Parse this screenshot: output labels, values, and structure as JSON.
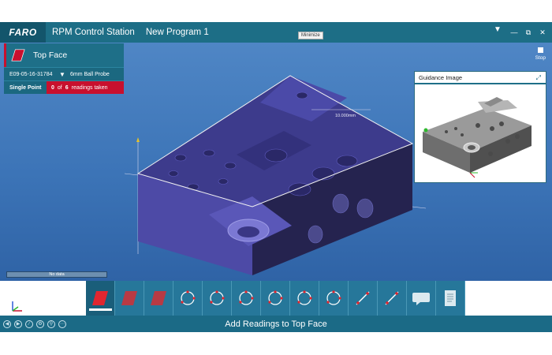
{
  "titlebar": {
    "logo": "FARO",
    "app_title": "RPM  Control Station",
    "program_title": "New Program 1",
    "tooltip": "Minimize",
    "chevron_icon": "chevron-down-icon",
    "window_buttons": [
      "min-icon",
      "restore-icon",
      "close-icon"
    ]
  },
  "stop": {
    "label": "Stop",
    "icon": "stop-icon"
  },
  "feature": {
    "name": "Top Face",
    "serial": "E09-05-16-31784",
    "probe": "6mm Ball Probe",
    "mode": "Single Point",
    "readings_taken": "0",
    "readings_of": "of",
    "readings_total": "6",
    "readings_suffix": "readings taken"
  },
  "model": {
    "dimension_label": "10.000mm"
  },
  "guidance": {
    "title": "Guidance Image",
    "expand_icon": "expand-icon"
  },
  "nodata": {
    "label": "No data"
  },
  "toolbar": {
    "tools": [
      {
        "name": "plane-red-active",
        "icon": "plane-icon"
      },
      {
        "name": "plane-red",
        "icon": "plane-icon"
      },
      {
        "name": "plane-red-2",
        "icon": "plane-icon"
      },
      {
        "name": "circle",
        "icon": "circle-points-icon"
      },
      {
        "name": "circle",
        "icon": "circle-points-icon"
      },
      {
        "name": "circle",
        "icon": "circle-points-icon"
      },
      {
        "name": "circle",
        "icon": "circle-points-icon"
      },
      {
        "name": "circle",
        "icon": "circle-points-icon"
      },
      {
        "name": "circle",
        "icon": "circle-points-icon"
      },
      {
        "name": "line",
        "icon": "line-icon"
      },
      {
        "name": "line",
        "icon": "line-icon"
      },
      {
        "name": "comment",
        "icon": "comment-icon"
      },
      {
        "name": "report",
        "icon": "report-icon"
      }
    ]
  },
  "bottombar": {
    "status": "Add Readings to Top Face",
    "nav_icons": [
      "back-icon",
      "forward-icon",
      "measure-icon",
      "settings-icon",
      "search-icon",
      "more-icon"
    ]
  },
  "colors": {
    "brand": "#1d6e86",
    "accent_red": "#c8102e",
    "workspace": "#3c74b7",
    "part": "#3b3a82"
  }
}
